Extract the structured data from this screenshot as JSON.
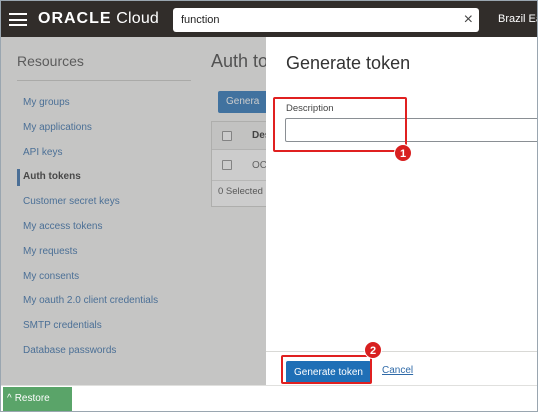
{
  "header": {
    "brand_bold": "ORACLE",
    "brand_light": " Cloud",
    "search_value": "function",
    "clear_icon": "×",
    "region": "Brazil Ea"
  },
  "sidebar": {
    "title": "Resources",
    "items": [
      {
        "label": "My groups"
      },
      {
        "label": "My applications"
      },
      {
        "label": "API keys"
      },
      {
        "label": "Auth tokens"
      },
      {
        "label": "Customer secret keys"
      },
      {
        "label": "My access tokens"
      },
      {
        "label": "My requests"
      },
      {
        "label": "My consents"
      },
      {
        "label": "My oauth 2.0 client credentials"
      },
      {
        "label": "SMTP credentials"
      },
      {
        "label": "Database passwords"
      }
    ],
    "active_index": 3
  },
  "main": {
    "title": "Auth to",
    "generate_button_partial": "Genera",
    "table": {
      "header_label": "Des",
      "row_label": "OC",
      "selected_text": "0 Selected"
    }
  },
  "panel": {
    "title": "Generate token",
    "description_label": "Description",
    "description_value": "",
    "primary_button": "Generate token",
    "cancel_link": "Cancel"
  },
  "annotations": {
    "marker_1": "1",
    "marker_2": "2",
    "color": "#d81f1f"
  },
  "bottom": {
    "restore_label": "Restore",
    "restore_icon": "^"
  },
  "colors": {
    "topbar": "#312d2a",
    "primary": "#1f6fb6",
    "link": "#2f6aa8",
    "restore": "#5aa469"
  }
}
